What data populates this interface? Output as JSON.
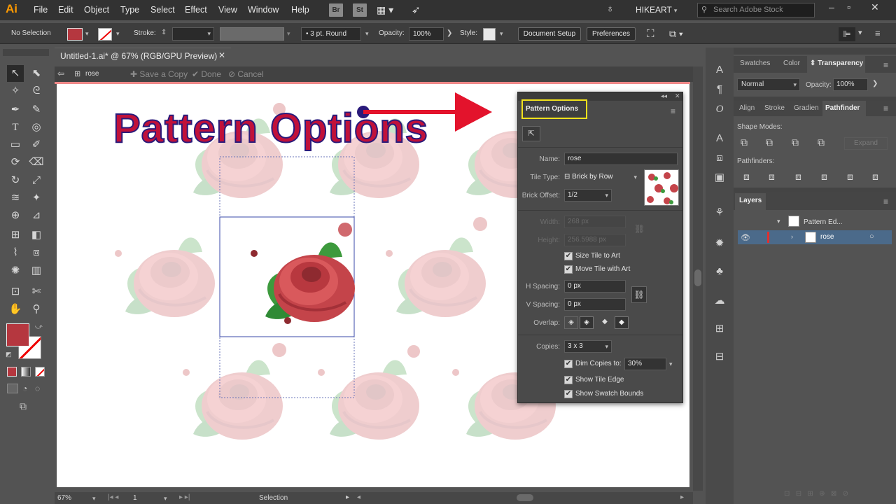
{
  "menubar": {
    "logo": "Ai",
    "items": [
      "File",
      "Edit",
      "Object",
      "Type",
      "Select",
      "Effect",
      "View",
      "Window",
      "Help"
    ],
    "app_icons": [
      "Br",
      "St"
    ],
    "workspace": "HIKEART",
    "search_placeholder": "Search Adobe Stock"
  },
  "control_bar": {
    "selection_label": "No Selection",
    "stroke_label": "Stroke:",
    "brush_value": "3 pt. Round",
    "opacity_label": "Opacity:",
    "opacity_value": "100%",
    "style_label": "Style:",
    "document_setup": "Document Setup",
    "preferences": "Preferences"
  },
  "document": {
    "tab_title": "Untitled-1.ai* @ 67% (RGB/GPU Preview)"
  },
  "pattern_bar": {
    "name": "rose",
    "save_copy": "Save a Copy",
    "done": "Done",
    "cancel": "Cancel"
  },
  "overlay": {
    "title": "Pattern Options"
  },
  "pattern_options": {
    "panel_title": "Pattern Options",
    "name_label": "Name:",
    "name_value": "rose",
    "tile_type_label": "Tile Type:",
    "tile_type_value": "Brick by Row",
    "brick_offset_label": "Brick Offset:",
    "brick_offset_value": "1/2",
    "width_label": "Width:",
    "width_value": "268 px",
    "height_label": "Height:",
    "height_value": "256.5988 px",
    "size_tile_label": "Size Tile to Art",
    "move_tile_label": "Move Tile with Art",
    "h_spacing_label": "H Spacing:",
    "h_spacing_value": "0 px",
    "v_spacing_label": "V Spacing:",
    "v_spacing_value": "0 px",
    "overlap_label": "Overlap:",
    "copies_label": "Copies:",
    "copies_value": "3 x 3",
    "dim_copies_label": "Dim Copies to:",
    "dim_copies_value": "30%",
    "show_tile_edge_label": "Show Tile Edge",
    "show_swatch_bounds_label": "Show Swatch Bounds"
  },
  "right_panels": {
    "tabs_top": [
      "Swatches",
      "Color",
      "Transparency"
    ],
    "blend_mode": "Normal",
    "opacity_label": "Opacity:",
    "opacity_value": "100%",
    "tabs_mid": [
      "Align",
      "Stroke",
      "Gradien",
      "Pathfinder"
    ],
    "shape_modes_label": "Shape Modes:",
    "expand_label": "Expand",
    "pathfinders_label": "Pathfinders:",
    "layers_tab": "Layers",
    "layer_parent": "Pattern Ed...",
    "layer_child": "rose"
  },
  "status": {
    "zoom": "67%",
    "artboard": "1",
    "tool": "Selection"
  },
  "colors": {
    "fill": "#b5373f",
    "overlay_text": "#c0113a",
    "overlay_outline": "#2a1a7a",
    "highlight_box": "#f2e21c",
    "selected_layer": "#4b6a8a"
  }
}
